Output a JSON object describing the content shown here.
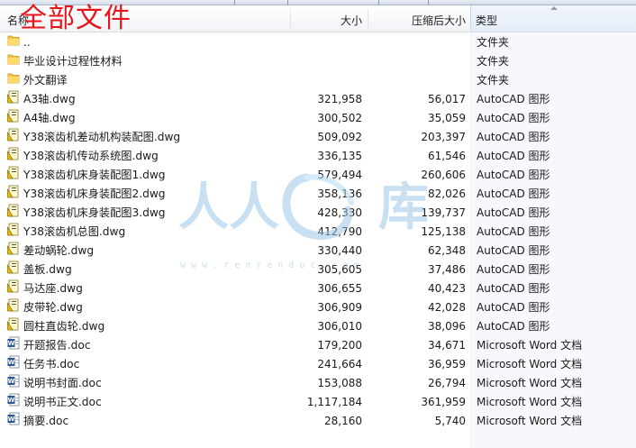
{
  "overlay_title": "全部文件",
  "columns": {
    "name": "名称",
    "size": "大小",
    "compressed": "压缩后大小",
    "type": "类型"
  },
  "watermark": {
    "chars": "人人",
    "char2": "库",
    "url": "w w w . r e n r e n d o c . c o m"
  },
  "files": [
    {
      "icon": "folder-up-icon",
      "name": "..",
      "size": "",
      "compressed": "",
      "type": "文件夹"
    },
    {
      "icon": "folder-icon",
      "name": "毕业设计过程性材料",
      "size": "",
      "compressed": "",
      "type": "文件夹"
    },
    {
      "icon": "folder-icon",
      "name": "外文翻译",
      "size": "",
      "compressed": "",
      "type": "文件夹"
    },
    {
      "icon": "dwg-icon",
      "name": "A3轴.dwg",
      "size": "321,958",
      "compressed": "56,017",
      "type": "AutoCAD 图形"
    },
    {
      "icon": "dwg-icon",
      "name": "A4轴.dwg",
      "size": "300,502",
      "compressed": "35,059",
      "type": "AutoCAD 图形"
    },
    {
      "icon": "dwg-icon",
      "name": "Y38滚齿机差动机构装配图.dwg",
      "size": "509,092",
      "compressed": "203,397",
      "type": "AutoCAD 图形"
    },
    {
      "icon": "dwg-icon",
      "name": "Y38滚齿机传动系统图.dwg",
      "size": "336,135",
      "compressed": "61,546",
      "type": "AutoCAD 图形"
    },
    {
      "icon": "dwg-icon",
      "name": "Y38滚齿机床身装配图1.dwg",
      "size": "579,494",
      "compressed": "260,606",
      "type": "AutoCAD 图形"
    },
    {
      "icon": "dwg-icon",
      "name": "Y38滚齿机床身装配图2.dwg",
      "size": "358,136",
      "compressed": "82,026",
      "type": "AutoCAD 图形"
    },
    {
      "icon": "dwg-icon",
      "name": "Y38滚齿机床身装配图3.dwg",
      "size": "428,330",
      "compressed": "139,737",
      "type": "AutoCAD 图形"
    },
    {
      "icon": "dwg-icon",
      "name": "Y38滚齿机总图.dwg",
      "size": "412,790",
      "compressed": "125,138",
      "type": "AutoCAD 图形"
    },
    {
      "icon": "dwg-icon",
      "name": "差动蜗轮.dwg",
      "size": "330,440",
      "compressed": "62,348",
      "type": "AutoCAD 图形"
    },
    {
      "icon": "dwg-icon",
      "name": "盖板.dwg",
      "size": "305,605",
      "compressed": "37,486",
      "type": "AutoCAD 图形"
    },
    {
      "icon": "dwg-icon",
      "name": "马达座.dwg",
      "size": "306,655",
      "compressed": "40,423",
      "type": "AutoCAD 图形"
    },
    {
      "icon": "dwg-icon",
      "name": "皮带轮.dwg",
      "size": "306,909",
      "compressed": "42,028",
      "type": "AutoCAD 图形"
    },
    {
      "icon": "dwg-icon",
      "name": "圆柱直齿轮.dwg",
      "size": "306,010",
      "compressed": "38,096",
      "type": "AutoCAD 图形"
    },
    {
      "icon": "doc-icon",
      "name": "开题报告.doc",
      "size": "179,200",
      "compressed": "34,671",
      "type": "Microsoft Word 文档"
    },
    {
      "icon": "doc-icon",
      "name": "任务书.doc",
      "size": "241,664",
      "compressed": "36,959",
      "type": "Microsoft Word 文档"
    },
    {
      "icon": "doc-icon",
      "name": "说明书封面.doc",
      "size": "153,088",
      "compressed": "26,794",
      "type": "Microsoft Word 文档"
    },
    {
      "icon": "doc-icon",
      "name": "说明书正文.doc",
      "size": "1,117,184",
      "compressed": "361,959",
      "type": "Microsoft Word 文档"
    },
    {
      "icon": "doc-icon",
      "name": "摘要.doc",
      "size": "28,160",
      "compressed": "5,740",
      "type": "Microsoft Word 文档"
    }
  ]
}
